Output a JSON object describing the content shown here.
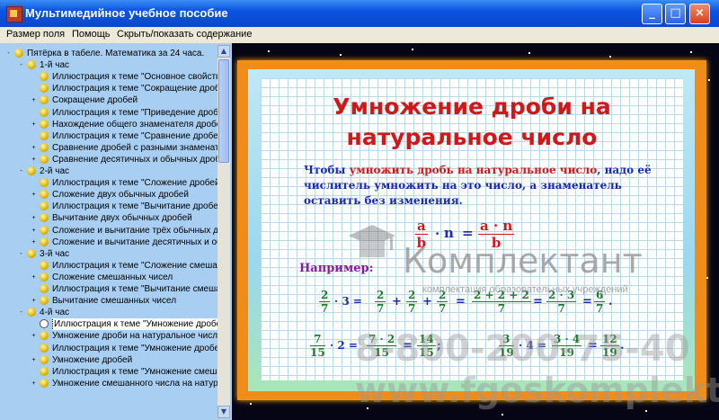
{
  "window": {
    "title": "Мультимедийное учебное пособие",
    "min": "_",
    "max": "□",
    "close": "×"
  },
  "menu": [
    "Размер поля",
    "Помощь",
    "Скрыть/показать содержание"
  ],
  "tree": [
    {
      "level": 0,
      "exp": "-",
      "label": "Пятёрка в табеле. Математика за 24 часа."
    },
    {
      "level": 1,
      "exp": "-",
      "label": "1-й час"
    },
    {
      "level": 2,
      "exp": "",
      "label": "Иллюстрация к теме \"Основное свойство дроби\""
    },
    {
      "level": 2,
      "exp": "",
      "label": "Иллюстрация к теме \"Сокращение дробей\""
    },
    {
      "level": 2,
      "exp": "+",
      "label": "Сокращение дробей"
    },
    {
      "level": 2,
      "exp": "",
      "label": "Иллюстрация к теме \"Приведение дробей\""
    },
    {
      "level": 2,
      "exp": "+",
      "label": "Нахождение общего знаменателя дробей"
    },
    {
      "level": 2,
      "exp": "",
      "label": "Иллюстрация к теме \"Сравнение дробей\""
    },
    {
      "level": 2,
      "exp": "+",
      "label": "Сравнение дробей с разными знаменателями"
    },
    {
      "level": 2,
      "exp": "+",
      "label": "Сравнение десятичных и обычных дробей"
    },
    {
      "level": 1,
      "exp": "-",
      "label": "2-й час"
    },
    {
      "level": 2,
      "exp": "",
      "label": "Иллюстрация к теме \"Сложение дробей\""
    },
    {
      "level": 2,
      "exp": "+",
      "label": "Сложение двух обычных дробей"
    },
    {
      "level": 2,
      "exp": "",
      "label": "Иллюстрация к теме \"Вычитание дробей\""
    },
    {
      "level": 2,
      "exp": "+",
      "label": "Вычитание двух обычных дробей"
    },
    {
      "level": 2,
      "exp": "+",
      "label": "Сложение и вычитание трёх обычных дробей"
    },
    {
      "level": 2,
      "exp": "+",
      "label": "Сложение и вычитание десятичных и обычных дробей"
    },
    {
      "level": 1,
      "exp": "-",
      "label": "3-й час"
    },
    {
      "level": 2,
      "exp": "",
      "label": "Иллюстрация к теме \"Сложение смешанных чисел\""
    },
    {
      "level": 2,
      "exp": "+",
      "label": "Сложение смешанных чисел"
    },
    {
      "level": 2,
      "exp": "",
      "label": "Иллюстрация к теме \"Вычитание смешанных чисел\""
    },
    {
      "level": 2,
      "exp": "+",
      "label": "Вычитание смешанных чисел"
    },
    {
      "level": 1,
      "exp": "-",
      "label": "4-й час"
    },
    {
      "level": 2,
      "exp": "",
      "label": "Иллюстрация к теме \"Умножение дробей\"",
      "selected": true
    },
    {
      "level": 2,
      "exp": "+",
      "label": "Умножение дроби на натуральное число"
    },
    {
      "level": 2,
      "exp": "",
      "label": "Иллюстрация к теме \"Умножение дробей\""
    },
    {
      "level": 2,
      "exp": "+",
      "label": "Умножение дробей"
    },
    {
      "level": 2,
      "exp": "",
      "label": "Иллюстрация к теме \"Умножение смешанных чисел\""
    },
    {
      "level": 2,
      "exp": "+",
      "label": "Умножение смешанного числа на натуральное число"
    }
  ],
  "slide": {
    "heading1": "Умножение дроби на",
    "heading2": "натуральное число",
    "rule": {
      "p1": "Чтобы ",
      "p2": "умножить дробь на натуральное число",
      "p3": ", надо её числитель умножить на это число, а знаменатель оставить без изменения."
    },
    "formula": {
      "a": "a",
      "b": "b",
      "dot": "·",
      "n": "n",
      "eq": "=",
      "num": "a · n",
      "den": "b"
    },
    "example_label": "Например:",
    "ex1": {
      "f1n": "2",
      "f1d": "7",
      "t1": "· 3 =",
      "f2n": "2",
      "f2d": "7",
      "plus1": "+",
      "f3n": "2",
      "f3d": "7",
      "plus2": "+",
      "f4n": "2",
      "f4d": "7",
      "eq1": "=",
      "f5n": "2 + 2 + 2",
      "f5d": "7",
      "eq2": "=",
      "f6n": "2 · 3",
      "f6d": "7",
      "eq3": "=",
      "f7n": "6",
      "f7d": "7",
      "end": "."
    },
    "ex2": {
      "f1n": "7",
      "f1d": "15",
      "t1": "· 2 =",
      "f2n": "7 · 2",
      "f2d": "15",
      "eq1": "=",
      "f3n": "14",
      "f3d": "15",
      "semi": ";"
    },
    "ex3": {
      "f1n": "3",
      "f1d": "19",
      "t1": "· 4 =",
      "f2n": "3 · 4",
      "f2d": "19",
      "eq1": "=",
      "f3n": "12",
      "f3d": "19",
      "end": "."
    }
  },
  "watermark": {
    "name": "Комплектант",
    "sub": "комплектация образовательных учреждений",
    "phone": "8-800-200-75-40",
    "url": "www.fgoskomplekt.ru"
  }
}
